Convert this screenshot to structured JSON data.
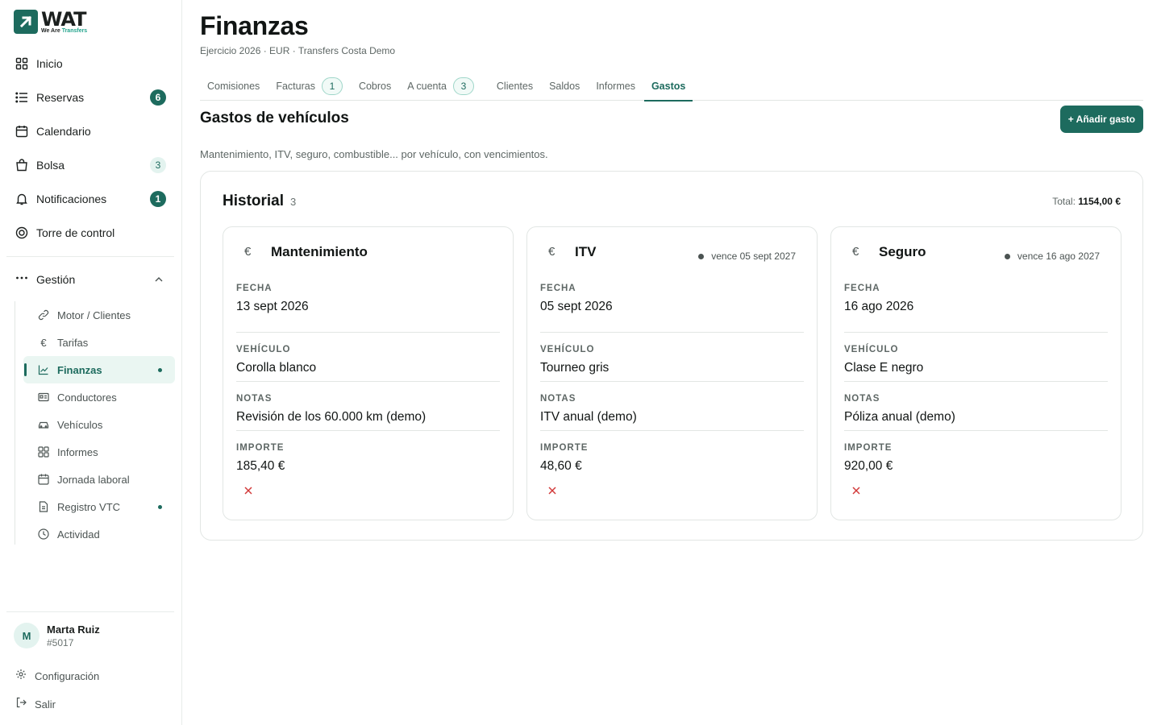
{
  "brand": {
    "name": "WAT",
    "tagline_a": "We Are",
    "tagline_b": "Transfers",
    "accent": "#1d6b5e"
  },
  "sidebar": {
    "items": [
      {
        "label": "Inicio",
        "icon": "grid-icon"
      },
      {
        "label": "Reservas",
        "icon": "list-icon",
        "badge": "6"
      },
      {
        "label": "Calendario",
        "icon": "calendar-icon"
      },
      {
        "label": "Bolsa",
        "icon": "bag-icon",
        "badge": "3"
      },
      {
        "label": "Notificaciones",
        "icon": "bell-icon",
        "badge": "1"
      },
      {
        "label": "Torre de control",
        "icon": "target-icon"
      }
    ],
    "group": {
      "label": "Gestión"
    },
    "subitems": [
      {
        "label": "Motor / Clientes",
        "icon": "link-icon"
      },
      {
        "label": "Tarifas",
        "icon": "euro-icon"
      },
      {
        "label": "Finanzas",
        "icon": "chart-icon"
      },
      {
        "label": "Conductores",
        "icon": "id-card-icon"
      },
      {
        "label": "Vehículos",
        "icon": "car-icon"
      },
      {
        "label": "Informes",
        "icon": "grid-icon"
      },
      {
        "label": "Jornada laboral",
        "icon": "calendar-icon"
      },
      {
        "label": "Registro VTC",
        "icon": "document-icon"
      },
      {
        "label": "Actividad",
        "icon": "clock-icon"
      }
    ],
    "user": {
      "initial": "M",
      "name": "Marta Ruiz",
      "id": "#5017"
    },
    "settings_label": "Configuración",
    "logout_label": "Salir"
  },
  "header": {
    "title": "Finanzas",
    "subtitle": "Ejercicio 2026 · EUR · Transfers Costa Demo"
  },
  "tabs": [
    {
      "label": "Comisiones"
    },
    {
      "label": "Facturas",
      "badge": "1"
    },
    {
      "label": "Cobros"
    },
    {
      "label": "A cuenta",
      "badge": "3"
    },
    {
      "label": "Clientes"
    },
    {
      "label": "Saldos"
    },
    {
      "label": "Informes"
    },
    {
      "label": "Gastos"
    }
  ],
  "section": {
    "title": "Gastos de vehículos",
    "add_button": "+ Añadir gasto",
    "description": "Mantenimiento, ITV, seguro, combustible... por vehículo, con vencimientos."
  },
  "history": {
    "title": "Historial",
    "count": "3",
    "total_label": "Total:",
    "total_value": "1154,00 €"
  },
  "field_labels": {
    "date": "FECHA",
    "vehicle": "VEHÍCULO",
    "notes": "NOTAS",
    "amount": "IMPORTE"
  },
  "expenses": [
    {
      "currency": "€",
      "title": "Mantenimiento",
      "due": "",
      "date": "13 sept 2026",
      "vehicle": "Corolla blanco",
      "notes": "Revisión de los 60.000 km (demo)",
      "amount": "185,40 €"
    },
    {
      "currency": "€",
      "title": "ITV",
      "due": "vence 05 sept 2027",
      "date": "05 sept 2026",
      "vehicle": "Tourneo gris",
      "notes": "ITV anual (demo)",
      "amount": "48,60 €"
    },
    {
      "currency": "€",
      "title": "Seguro",
      "due": "vence 16 ago 2027",
      "date": "16 ago 2026",
      "vehicle": "Clase E negro",
      "notes": "Póliza anual (demo)",
      "amount": "920,00 €"
    }
  ]
}
